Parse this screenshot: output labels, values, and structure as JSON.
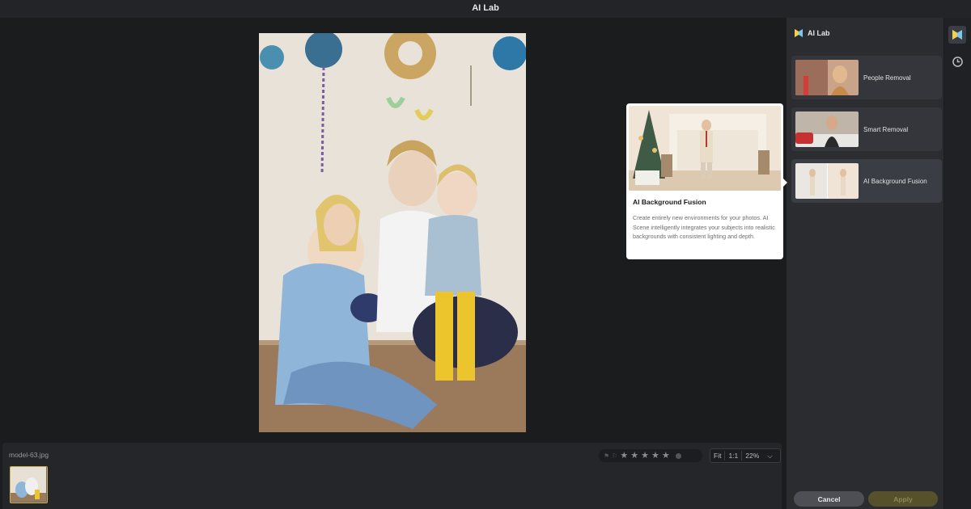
{
  "app": {
    "title": "AI Lab"
  },
  "canvas": {
    "image_alt": "family-portrait-photo"
  },
  "filmstrip": {
    "filename": "model-63.jpg",
    "rating": {
      "stars": 0,
      "max_stars": 5,
      "star_glyph": "★"
    },
    "zoom": {
      "fit_label": "Fit",
      "one_to_one_label": "1:1",
      "zoom_value": "22%",
      "chevron": "⌵"
    }
  },
  "panel": {
    "header": {
      "title": "AI Lab"
    },
    "features": [
      {
        "label": "People Removal"
      },
      {
        "label": "Smart Removal"
      },
      {
        "label": "AI Background Fusion"
      }
    ],
    "buttons": {
      "cancel": "Cancel",
      "apply": "Apply"
    }
  },
  "tooltip": {
    "title": "AI Background Fusion",
    "description": "Create entirely new environments for your photos. AI Scene intelligently integrates your subjects into realistic backgrounds with consistent lighting and depth."
  },
  "rail": {
    "icons": [
      "ai-lab-icon",
      "history-clock-icon"
    ]
  },
  "colors": {
    "accent": "#c9b04a",
    "panel_bg": "#2a2c30",
    "app_bg": "#1b1c1e",
    "apply_btn": "#56512b"
  }
}
